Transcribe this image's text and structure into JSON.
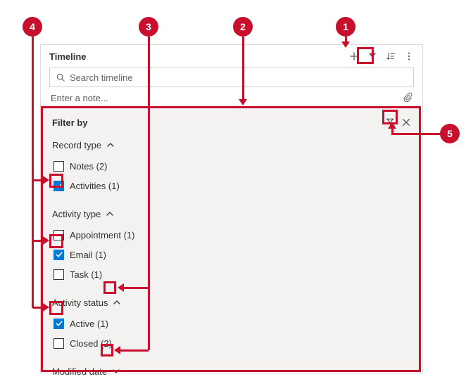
{
  "annotations": {
    "b1": "1",
    "b2": "2",
    "b3": "3",
    "b4": "4",
    "b5": "5"
  },
  "header": {
    "title": "Timeline",
    "search_placeholder": "Search timeline",
    "note_placeholder": "Enter a note..."
  },
  "filter": {
    "title": "Filter by",
    "sections": {
      "record_type": {
        "label": "Record type",
        "expanded": true,
        "opts": {
          "notes": {
            "label": "Notes (2)",
            "checked": false
          },
          "acts": {
            "label": "Activities (1)",
            "checked": true
          }
        }
      },
      "activity_type": {
        "label": "Activity type",
        "expanded": true,
        "opts": {
          "appt": {
            "label": "Appointment (1)",
            "checked": false
          },
          "email": {
            "label": "Email (1)",
            "checked": true
          },
          "task": {
            "label": "Task (1)",
            "checked": false
          }
        }
      },
      "activity_status": {
        "label": "Activity status",
        "expanded": true,
        "opts": {
          "active": {
            "label": "Active (1)",
            "checked": true
          },
          "closed": {
            "label": "Closed (2)",
            "checked": false
          }
        }
      },
      "modified_date": {
        "label": "Modified date",
        "expanded": false
      }
    }
  }
}
